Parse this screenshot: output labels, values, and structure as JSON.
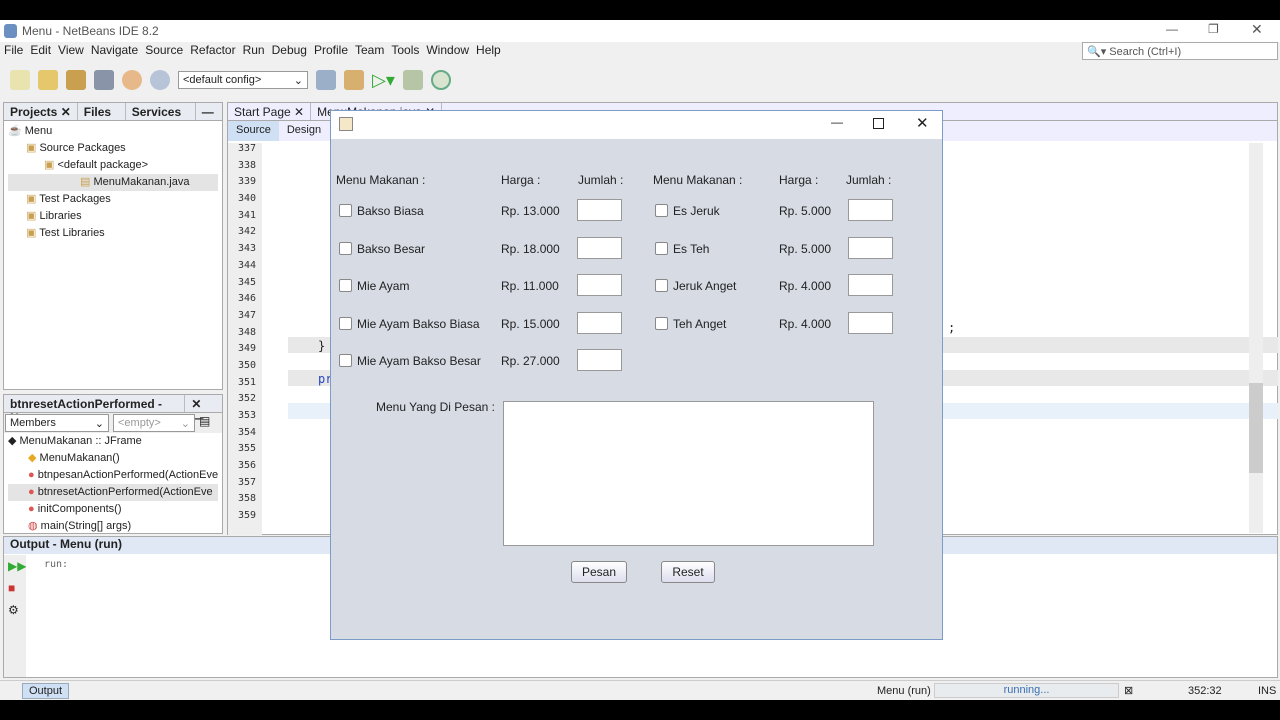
{
  "window": {
    "title": "Menu - NetBeans IDE 8.2",
    "search_placeholder": "Search (Ctrl+I)"
  },
  "menu": [
    "File",
    "Edit",
    "View",
    "Navigate",
    "Source",
    "Refactor",
    "Run",
    "Debug",
    "Profile",
    "Team",
    "Tools",
    "Window",
    "Help"
  ],
  "toolbar": {
    "config": "<default config>"
  },
  "projects": {
    "tabs": [
      "Projects",
      "Files",
      "Services"
    ],
    "tree": [
      "Menu",
      "Source Packages",
      "<default package>",
      "MenuMakanan.java",
      "Test Packages",
      "Libraries",
      "Test Libraries"
    ]
  },
  "navigator": {
    "title": "btnresetActionPerformed - N...",
    "filter": "Members",
    "empty": "<empty>",
    "root": "MenuMakanan :: JFrame",
    "items": [
      "MenuMakanan()",
      "btnpesanActionPerformed(ActionEve",
      "btnresetActionPerformed(ActionEve",
      "initComponents()",
      "main(String[] args)"
    ]
  },
  "editor": {
    "tabs": [
      "Start Page",
      "MenuMakanan.java"
    ],
    "view_tabs": [
      "Source",
      "Design"
    ],
    "line_numbers": [
      "337",
      "338",
      "339",
      "340",
      "341",
      "342",
      "343",
      "344",
      "345",
      "346",
      "347",
      "348",
      "349",
      "350",
      "351",
      "352",
      "353",
      "354",
      "355",
      "356",
      "357",
      "358",
      "359"
    ],
    "code": {
      "brace": "}",
      "pr": "pr",
      "semi": ";"
    }
  },
  "dialog": {
    "headers": {
      "menu": "Menu Makanan :",
      "harga": "Harga :",
      "jumlah": "Jumlah :"
    },
    "food": [
      {
        "name": "Bakso Biasa",
        "price": "Rp. 13.000"
      },
      {
        "name": "Bakso Besar",
        "price": "Rp. 18.000"
      },
      {
        "name": "Mie Ayam",
        "price": "Rp. 11.000"
      },
      {
        "name": "Mie Ayam Bakso Biasa",
        "price": "Rp. 15.000"
      },
      {
        "name": "Mie Ayam Bakso Besar",
        "price": "Rp. 27.000"
      }
    ],
    "drinks": [
      {
        "name": "Es Jeruk",
        "price": "Rp. 5.000"
      },
      {
        "name": "Es Teh",
        "price": "Rp. 5.000"
      },
      {
        "name": "Jeruk Anget",
        "price": "Rp. 4.000"
      },
      {
        "name": "Teh Anget",
        "price": "Rp. 4.000"
      }
    ],
    "ordered_label": "Menu Yang Di Pesan :",
    "pesan": "Pesan",
    "reset": "Reset"
  },
  "output": {
    "title": "Output - Menu (run)",
    "text": "run:",
    "tab": "Output"
  },
  "status": {
    "task": "Menu (run)",
    "progress": "running...",
    "position": "352:32",
    "mode": "INS"
  }
}
